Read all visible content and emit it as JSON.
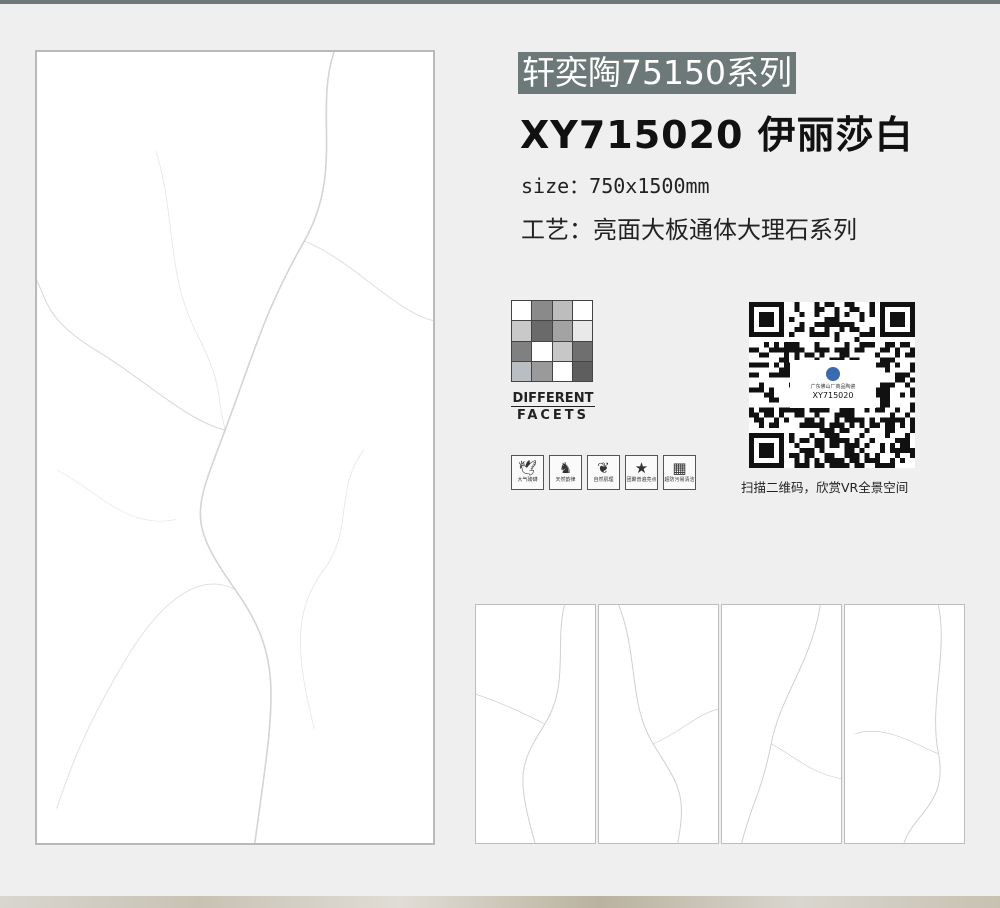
{
  "product": {
    "series_title": "轩奕陶75150系列",
    "model": "XY715020 伊丽莎白",
    "size": "size：750x1500mm",
    "process": "工艺：亮面大板通体大理石系列"
  },
  "facets": {
    "line1": "DIFFERENT",
    "line2": "FACETS",
    "colors": [
      "#ffffff",
      "#8a8a8a",
      "#bdbdbd",
      "#ffffff",
      "#c9c9c9",
      "#6a6a6a",
      "#a3a3a3",
      "#e9e9e9",
      "#808080",
      "#ffffff",
      "#c7c7c7",
      "#6f6f6f",
      "#b8bec1",
      "#9a9a9a",
      "#ffffff",
      "#5e5e5e"
    ]
  },
  "features": [
    {
      "icon": "eagle-icon",
      "glyph": "🕊",
      "caption": "大气磅礴"
    },
    {
      "icon": "deer-icon",
      "glyph": "♞",
      "caption": "天然韵律"
    },
    {
      "icon": "leaf-icon",
      "glyph": "❦",
      "caption": "自然肌理"
    },
    {
      "icon": "star-icon",
      "glyph": "★",
      "caption": "团聚普遍亮点"
    },
    {
      "icon": "texture-icon",
      "glyph": "▦",
      "caption": "超防污易清洁"
    }
  ],
  "qr": {
    "brand": "广东佛山厂商品陶瓷",
    "code": "XY715020",
    "caption": "扫描二维码，欣赏VR全景空间"
  }
}
